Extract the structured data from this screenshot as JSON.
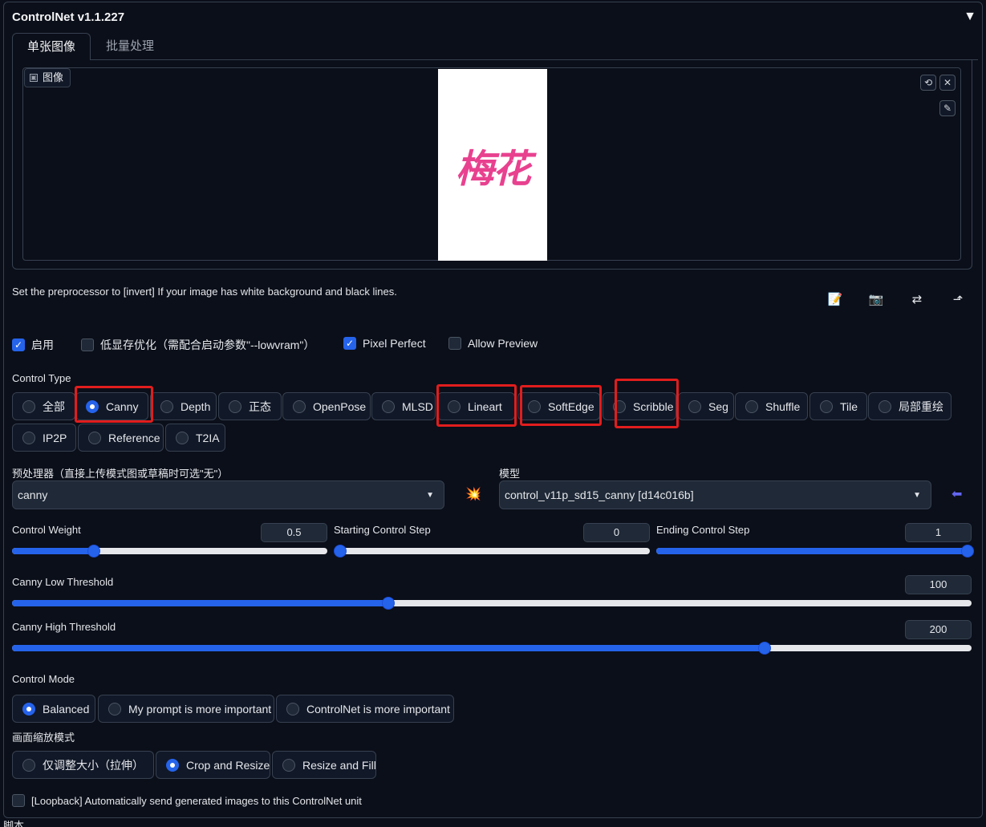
{
  "header": {
    "title": "ControlNet v1.1.227",
    "collapse_icon": "▼"
  },
  "tabs": [
    {
      "label": "单张图像",
      "active": true
    },
    {
      "label": "批量处理",
      "active": false
    }
  ],
  "image_panel": {
    "label": "图像",
    "preview_text": "梅花",
    "reset_icon": "⟲",
    "close_icon": "✕",
    "edit_icon": "✎"
  },
  "hint": "Set the preprocessor to [invert] If your image has white background and black lines.",
  "toolbar": {
    "new_canvas_icon": "📝",
    "camera_icon": "📷",
    "swap_icon": "⇄",
    "send_icon": "⬏"
  },
  "options": {
    "enable": {
      "label": "启用",
      "checked": true
    },
    "lowvram": {
      "label": "低显存优化（需配合启动参数\"--lowvram\"）",
      "checked": false
    },
    "pixel_perfect": {
      "label": "Pixel Perfect",
      "checked": true
    },
    "allow_preview": {
      "label": "Allow Preview",
      "checked": false
    }
  },
  "control_type": {
    "label": "Control Type",
    "items": [
      "全部",
      "Canny",
      "Depth",
      "正态",
      "OpenPose",
      "MLSD",
      "Lineart",
      "SoftEdge",
      "Scribble",
      "Seg",
      "Shuffle",
      "Tile",
      "局部重绘",
      "IP2P",
      "Reference",
      "T2IA"
    ],
    "selected": "Canny"
  },
  "preprocessor": {
    "label": "预处理器（直接上传模式图或草稿时可选\"无\"）",
    "value": "canny",
    "run_icon": "💥"
  },
  "model": {
    "label": "模型",
    "value": "control_v11p_sd15_canny [d14c016b]",
    "refresh_icon": "⬅"
  },
  "sliders": {
    "weight": {
      "label": "Control Weight",
      "value": "0.5",
      "fraction": 0.26
    },
    "start": {
      "label": "Starting Control Step",
      "value": "0",
      "fraction": 0.0
    },
    "end": {
      "label": "Ending Control Step",
      "value": "1",
      "fraction": 1.0
    },
    "low": {
      "label": "Canny Low Threshold",
      "value": "100",
      "fraction": 0.392
    },
    "high": {
      "label": "Canny High Threshold",
      "value": "200",
      "fraction": 0.784
    }
  },
  "control_mode": {
    "label": "Control Mode",
    "items": [
      "Balanced",
      "My prompt is more important",
      "ControlNet is more important"
    ],
    "selected": "Balanced"
  },
  "resize_mode": {
    "label": "画面缩放模式",
    "items": [
      "仅调整大小（拉伸）",
      "Crop and Resize",
      "Resize and Fill"
    ],
    "selected": "Crop and Resize"
  },
  "loopback": {
    "label": "[Loopback] Automatically send generated images to this ControlNet unit",
    "checked": false
  },
  "footer": {
    "label": "脚本"
  }
}
